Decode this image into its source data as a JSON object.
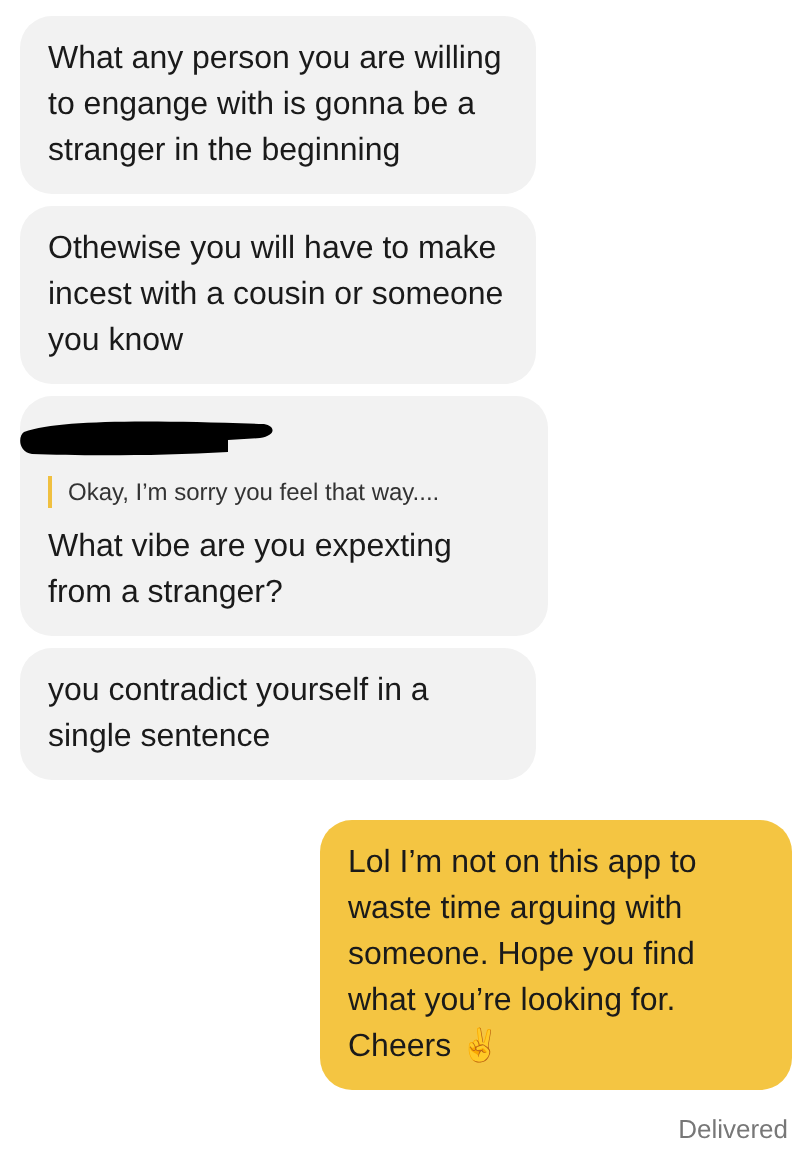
{
  "messages": [
    {
      "kind": "incoming",
      "text": "What any person you are willing to engange with is gonna be a stranger in the beginning"
    },
    {
      "kind": "incoming",
      "text": "Othewise you will have to make incest with a cousin or someone you know"
    },
    {
      "kind": "reply",
      "quote": "Okay, I’m sorry you feel that way....",
      "text": "What vibe are you expexting from a stranger?",
      "redacted": true
    },
    {
      "kind": "incoming",
      "text": "you contradict yourself in a single sentence"
    },
    {
      "kind": "outgoing",
      "text": "Lol I’m not on this app to waste time arguing with someone. Hope you find what you’re looking for. Cheers ✌️"
    }
  ],
  "status": "Delivered"
}
